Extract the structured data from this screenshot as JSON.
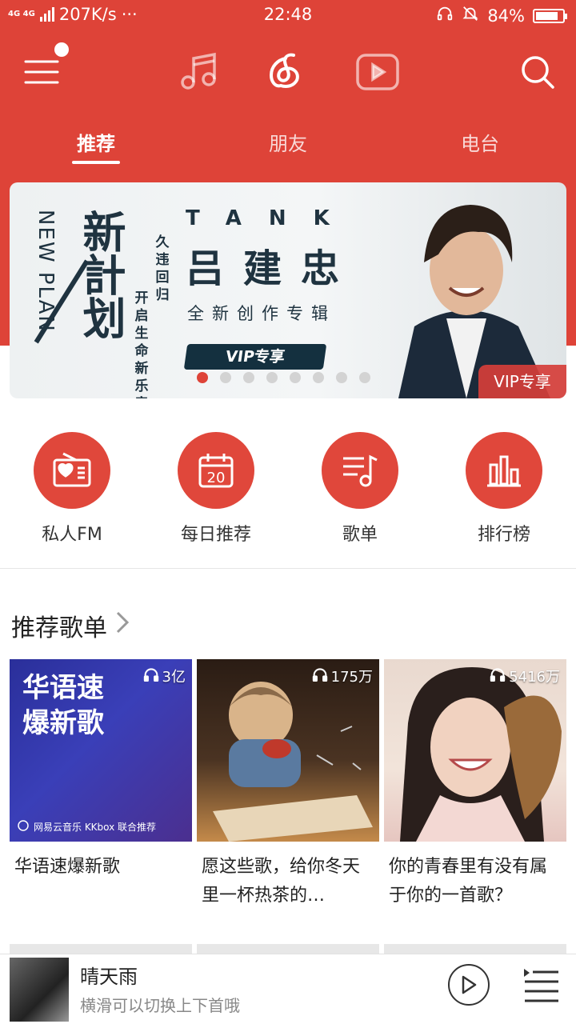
{
  "status_bar": {
    "network": "4G 4G",
    "speed": "207K/s",
    "dots": "···",
    "time": "22:48",
    "battery": "84%",
    "battery_level": 0.84
  },
  "top_nav": {
    "icons": [
      "menu-icon",
      "music-note-icon",
      "netease-logo-icon",
      "video-icon",
      "search-icon"
    ]
  },
  "tabs": [
    "推荐",
    "朋友",
    "电台"
  ],
  "active_tab": 0,
  "banner": {
    "new_plan_vertical": "NEW PLAN",
    "new_plan_big": "新計划",
    "new_plan_sub_cols": [
      "久违回归",
      "开启生命新乐章"
    ],
    "tank": "TANK",
    "artist": "吕建忠",
    "desc": "全新创作专辑",
    "vip_button": "VIP专享",
    "corner_tag": "VIP专享",
    "dot_count": 8,
    "active_dot": 0
  },
  "quick_actions": [
    {
      "label": "私人FM",
      "icon": "radio-heart-icon"
    },
    {
      "label": "每日推荐",
      "icon": "calendar-icon",
      "icon_text": "20"
    },
    {
      "label": "歌单",
      "icon": "playlist-icon"
    },
    {
      "label": "排行榜",
      "icon": "bar-chart-icon"
    }
  ],
  "section": {
    "title": "推荐歌单"
  },
  "playlists": [
    {
      "title": "华语速爆新歌",
      "plays": "3亿",
      "cover_text": "华语速爆新歌",
      "cover_footer": "网易云音乐 KKbox 联合推荐"
    },
    {
      "title": "愿这些歌，给你冬天里一杯热茶的…",
      "plays": "175万"
    },
    {
      "title": "你的青春里有没有属于你的一首歌？",
      "plays": "5416万"
    }
  ],
  "player": {
    "song": "晴天雨",
    "hint": "横滑可以切换上下首哦"
  },
  "colors": {
    "brand_red": "#de4338",
    "text": "#222222"
  }
}
